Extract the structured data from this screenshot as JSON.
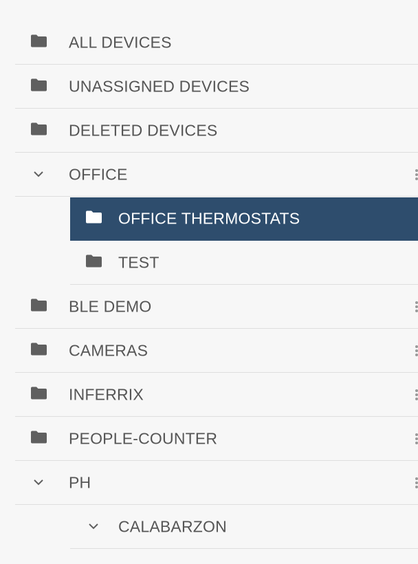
{
  "colors": {
    "background": "#f7f7f7",
    "text": "#555555",
    "icon": "#5f5f5f",
    "selected_bg": "#2e4d6d",
    "selected_text": "#ffffff",
    "divider": "#dedede"
  },
  "tree": {
    "items": [
      {
        "label": "ALL DEVICES",
        "icon": "folder-icon"
      },
      {
        "label": "UNASSIGNED DEVICES",
        "icon": "folder-icon"
      },
      {
        "label": "DELETED DEVICES",
        "icon": "folder-icon"
      },
      {
        "label": "OFFICE",
        "icon": "chevron-down-icon",
        "expanded": true,
        "has_menu": true
      },
      {
        "label": "OFFICE THERMOSTATS",
        "icon": "folder-icon",
        "selected": true
      },
      {
        "label": "TEST",
        "icon": "folder-icon"
      },
      {
        "label": "BLE DEMO",
        "icon": "folder-icon",
        "has_menu": true
      },
      {
        "label": "CAMERAS",
        "icon": "folder-icon",
        "has_menu": true
      },
      {
        "label": "INFERRIX",
        "icon": "folder-icon",
        "has_menu": true
      },
      {
        "label": "PEOPLE-COUNTER",
        "icon": "folder-icon",
        "has_menu": true
      },
      {
        "label": "PH",
        "icon": "chevron-down-icon",
        "expanded": true,
        "has_menu": true
      },
      {
        "label": "CALABARZON",
        "icon": "chevron-down-icon",
        "expanded": true
      }
    ]
  }
}
